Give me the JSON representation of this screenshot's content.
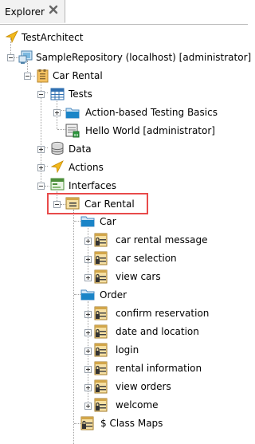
{
  "tab": {
    "label": "Explorer",
    "close_icon": "close-icon"
  },
  "colors": {
    "highlight": "#e84b4b",
    "tree_lines": "#a0a0a0",
    "folder_blue": "#1a84c7"
  },
  "tree": {
    "root": "TestArchitect",
    "repository": "SampleRepository (localhost) [administrator]",
    "project": "Car Rental",
    "tests": "Tests",
    "test_items": [
      "Action-based Testing Basics",
      "Hello World [administrator]"
    ],
    "data": "Data",
    "actions": "Actions",
    "interfaces": "Interfaces",
    "interface_file": "Car Rental",
    "car_folder": "Car",
    "car_items": [
      "car rental message",
      "car selection",
      "view cars"
    ],
    "order_folder": "Order",
    "order_items": [
      "confirm reservation",
      "date and location",
      "login",
      "rental information",
      "view orders",
      "welcome"
    ],
    "class_maps": "$ Class Maps"
  }
}
